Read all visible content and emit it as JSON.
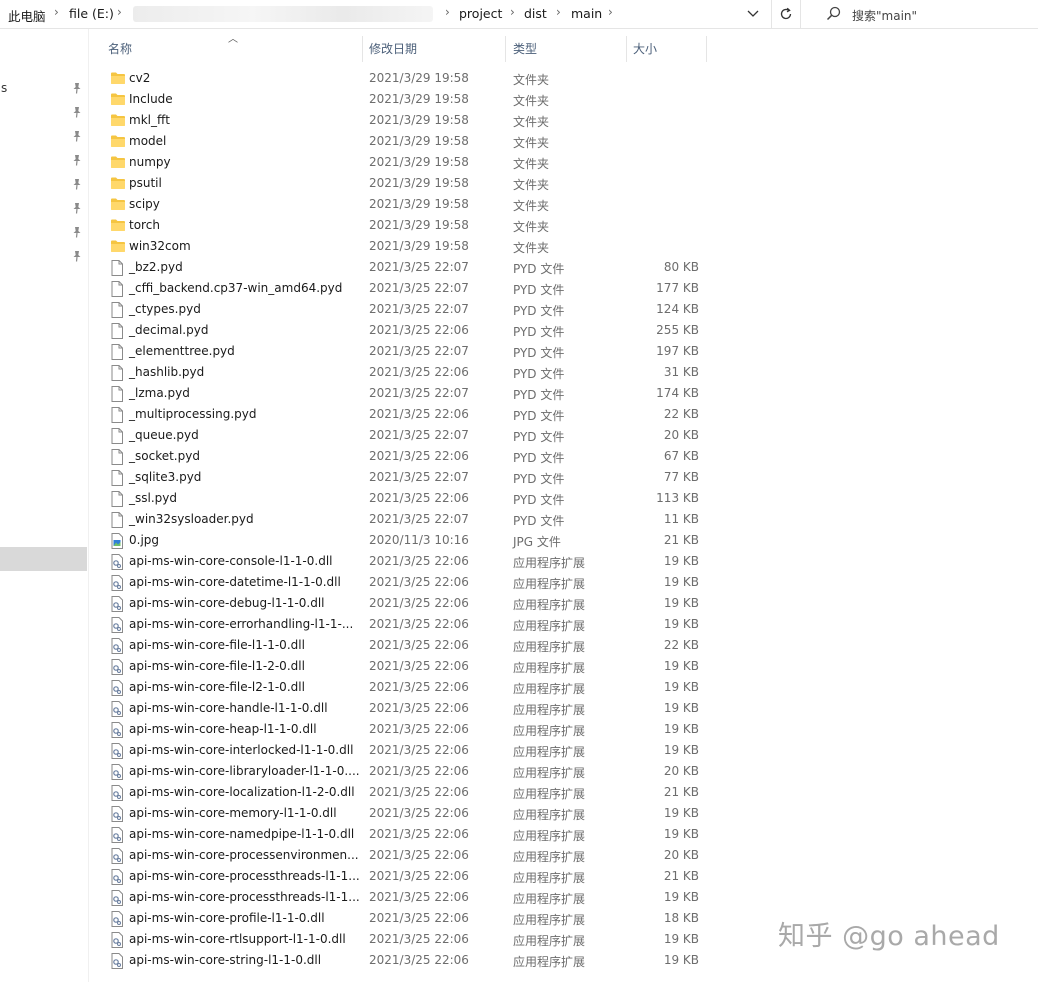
{
  "address_bar": {
    "crumbs": [
      "此电脑",
      "file (E:)",
      "project",
      "dist",
      "main"
    ],
    "refresh_icon": "refresh-icon",
    "dropdown_icon": "chevron-down-icon"
  },
  "search": {
    "placeholder": "搜索\"main\"",
    "icon": "search-icon"
  },
  "nav": {
    "partial_label": "s",
    "pin_icon": "pin-icon"
  },
  "columns": {
    "name": "名称",
    "date": "修改日期",
    "type": "类型",
    "size": "大小"
  },
  "watermark": "知乎 @go ahead",
  "files": [
    {
      "name": "cv2",
      "date": "2021/3/29 19:58",
      "type": "文件夹",
      "size": "",
      "kind": "folder"
    },
    {
      "name": "Include",
      "date": "2021/3/29 19:58",
      "type": "文件夹",
      "size": "",
      "kind": "folder"
    },
    {
      "name": "mkl_fft",
      "date": "2021/3/29 19:58",
      "type": "文件夹",
      "size": "",
      "kind": "folder"
    },
    {
      "name": "model",
      "date": "2021/3/29 19:58",
      "type": "文件夹",
      "size": "",
      "kind": "folder"
    },
    {
      "name": "numpy",
      "date": "2021/3/29 19:58",
      "type": "文件夹",
      "size": "",
      "kind": "folder"
    },
    {
      "name": "psutil",
      "date": "2021/3/29 19:58",
      "type": "文件夹",
      "size": "",
      "kind": "folder"
    },
    {
      "name": "scipy",
      "date": "2021/3/29 19:58",
      "type": "文件夹",
      "size": "",
      "kind": "folder"
    },
    {
      "name": "torch",
      "date": "2021/3/29 19:58",
      "type": "文件夹",
      "size": "",
      "kind": "folder"
    },
    {
      "name": "win32com",
      "date": "2021/3/29 19:58",
      "type": "文件夹",
      "size": "",
      "kind": "folder"
    },
    {
      "name": "_bz2.pyd",
      "date": "2021/3/25 22:07",
      "type": "PYD 文件",
      "size": "80 KB",
      "kind": "file"
    },
    {
      "name": "_cffi_backend.cp37-win_amd64.pyd",
      "date": "2021/3/25 22:07",
      "type": "PYD 文件",
      "size": "177 KB",
      "kind": "file"
    },
    {
      "name": "_ctypes.pyd",
      "date": "2021/3/25 22:07",
      "type": "PYD 文件",
      "size": "124 KB",
      "kind": "file"
    },
    {
      "name": "_decimal.pyd",
      "date": "2021/3/25 22:06",
      "type": "PYD 文件",
      "size": "255 KB",
      "kind": "file"
    },
    {
      "name": "_elementtree.pyd",
      "date": "2021/3/25 22:07",
      "type": "PYD 文件",
      "size": "197 KB",
      "kind": "file"
    },
    {
      "name": "_hashlib.pyd",
      "date": "2021/3/25 22:06",
      "type": "PYD 文件",
      "size": "31 KB",
      "kind": "file"
    },
    {
      "name": "_lzma.pyd",
      "date": "2021/3/25 22:07",
      "type": "PYD 文件",
      "size": "174 KB",
      "kind": "file"
    },
    {
      "name": "_multiprocessing.pyd",
      "date": "2021/3/25 22:06",
      "type": "PYD 文件",
      "size": "22 KB",
      "kind": "file"
    },
    {
      "name": "_queue.pyd",
      "date": "2021/3/25 22:07",
      "type": "PYD 文件",
      "size": "20 KB",
      "kind": "file"
    },
    {
      "name": "_socket.pyd",
      "date": "2021/3/25 22:06",
      "type": "PYD 文件",
      "size": "67 KB",
      "kind": "file"
    },
    {
      "name": "_sqlite3.pyd",
      "date": "2021/3/25 22:07",
      "type": "PYD 文件",
      "size": "77 KB",
      "kind": "file"
    },
    {
      "name": "_ssl.pyd",
      "date": "2021/3/25 22:06",
      "type": "PYD 文件",
      "size": "113 KB",
      "kind": "file"
    },
    {
      "name": "_win32sysloader.pyd",
      "date": "2021/3/25 22:07",
      "type": "PYD 文件",
      "size": "11 KB",
      "kind": "file"
    },
    {
      "name": "0.jpg",
      "date": "2020/11/3 10:16",
      "type": "JPG 文件",
      "size": "21 KB",
      "kind": "image"
    },
    {
      "name": "api-ms-win-core-console-l1-1-0.dll",
      "date": "2021/3/25 22:06",
      "type": "应用程序扩展",
      "size": "19 KB",
      "kind": "dll"
    },
    {
      "name": "api-ms-win-core-datetime-l1-1-0.dll",
      "date": "2021/3/25 22:06",
      "type": "应用程序扩展",
      "size": "19 KB",
      "kind": "dll"
    },
    {
      "name": "api-ms-win-core-debug-l1-1-0.dll",
      "date": "2021/3/25 22:06",
      "type": "应用程序扩展",
      "size": "19 KB",
      "kind": "dll"
    },
    {
      "name": "api-ms-win-core-errorhandling-l1-1-...",
      "date": "2021/3/25 22:06",
      "type": "应用程序扩展",
      "size": "19 KB",
      "kind": "dll"
    },
    {
      "name": "api-ms-win-core-file-l1-1-0.dll",
      "date": "2021/3/25 22:06",
      "type": "应用程序扩展",
      "size": "22 KB",
      "kind": "dll"
    },
    {
      "name": "api-ms-win-core-file-l1-2-0.dll",
      "date": "2021/3/25 22:06",
      "type": "应用程序扩展",
      "size": "19 KB",
      "kind": "dll"
    },
    {
      "name": "api-ms-win-core-file-l2-1-0.dll",
      "date": "2021/3/25 22:06",
      "type": "应用程序扩展",
      "size": "19 KB",
      "kind": "dll"
    },
    {
      "name": "api-ms-win-core-handle-l1-1-0.dll",
      "date": "2021/3/25 22:06",
      "type": "应用程序扩展",
      "size": "19 KB",
      "kind": "dll"
    },
    {
      "name": "api-ms-win-core-heap-l1-1-0.dll",
      "date": "2021/3/25 22:06",
      "type": "应用程序扩展",
      "size": "19 KB",
      "kind": "dll"
    },
    {
      "name": "api-ms-win-core-interlocked-l1-1-0.dll",
      "date": "2021/3/25 22:06",
      "type": "应用程序扩展",
      "size": "19 KB",
      "kind": "dll"
    },
    {
      "name": "api-ms-win-core-libraryloader-l1-1-0....",
      "date": "2021/3/25 22:06",
      "type": "应用程序扩展",
      "size": "20 KB",
      "kind": "dll"
    },
    {
      "name": "api-ms-win-core-localization-l1-2-0.dll",
      "date": "2021/3/25 22:06",
      "type": "应用程序扩展",
      "size": "21 KB",
      "kind": "dll"
    },
    {
      "name": "api-ms-win-core-memory-l1-1-0.dll",
      "date": "2021/3/25 22:06",
      "type": "应用程序扩展",
      "size": "19 KB",
      "kind": "dll"
    },
    {
      "name": "api-ms-win-core-namedpipe-l1-1-0.dll",
      "date": "2021/3/25 22:06",
      "type": "应用程序扩展",
      "size": "19 KB",
      "kind": "dll"
    },
    {
      "name": "api-ms-win-core-processenvironmen...",
      "date": "2021/3/25 22:06",
      "type": "应用程序扩展",
      "size": "20 KB",
      "kind": "dll"
    },
    {
      "name": "api-ms-win-core-processthreads-l1-1...",
      "date": "2021/3/25 22:06",
      "type": "应用程序扩展",
      "size": "21 KB",
      "kind": "dll"
    },
    {
      "name": "api-ms-win-core-processthreads-l1-1...",
      "date": "2021/3/25 22:06",
      "type": "应用程序扩展",
      "size": "19 KB",
      "kind": "dll"
    },
    {
      "name": "api-ms-win-core-profile-l1-1-0.dll",
      "date": "2021/3/25 22:06",
      "type": "应用程序扩展",
      "size": "18 KB",
      "kind": "dll"
    },
    {
      "name": "api-ms-win-core-rtlsupport-l1-1-0.dll",
      "date": "2021/3/25 22:06",
      "type": "应用程序扩展",
      "size": "19 KB",
      "kind": "dll"
    },
    {
      "name": "api-ms-win-core-string-l1-1-0.dll",
      "date": "2021/3/25 22:06",
      "type": "应用程序扩展",
      "size": "19 KB",
      "kind": "dll"
    }
  ]
}
